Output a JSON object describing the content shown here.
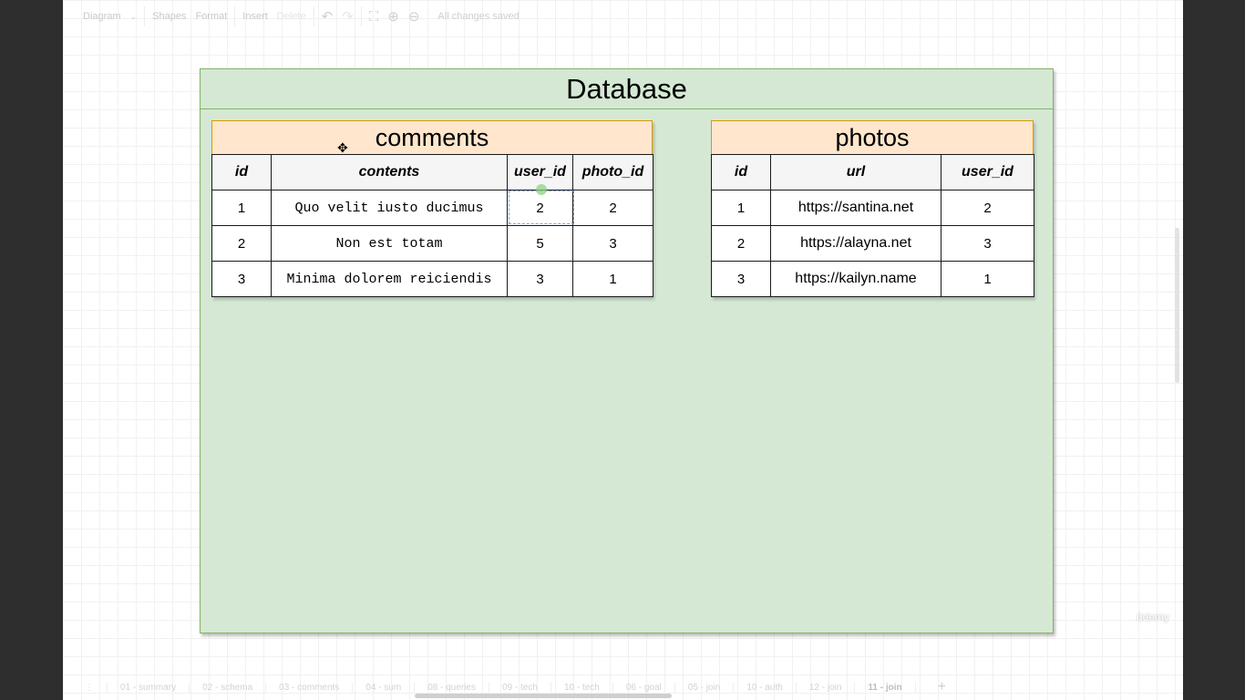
{
  "toolbar": {
    "diagram_menu": "Diagram",
    "shapes": "Shapes",
    "format": "Format",
    "insert": "Insert",
    "delete": "Delete",
    "status": "All changes saved"
  },
  "database": {
    "title": "Database"
  },
  "comments_table": {
    "title": "comments",
    "columns": [
      "id",
      "contents",
      "user_id",
      "photo_id"
    ],
    "rows": [
      [
        "1",
        "Quo velit iusto ducimus",
        "2",
        "2"
      ],
      [
        "2",
        "Non est totam",
        "5",
        "3"
      ],
      [
        "3",
        "Minima dolorem reiciendis",
        "3",
        "1"
      ]
    ]
  },
  "photos_table": {
    "title": "photos",
    "columns": [
      "id",
      "url",
      "user_id"
    ],
    "rows": [
      [
        "1",
        "https://santina.net",
        "2"
      ],
      [
        "2",
        "https://alayna.net",
        "3"
      ],
      [
        "3",
        "https://kailyn.name",
        "1"
      ]
    ]
  },
  "page_tabs": [
    "01 - summary",
    "02 - schema",
    "03 - comments",
    "04 - sum",
    "08 - queries",
    "09 - tech",
    "10 - tech",
    "06 - goal",
    "05 - join",
    "10 - auth",
    "12 - join",
    "11 - join"
  ],
  "active_tab": "11 - join",
  "watermark": "ûdemy",
  "colors": {
    "container_fill": "#d5e8d4",
    "container_stroke": "#82b366",
    "table_title_fill": "#ffe6cc",
    "table_title_stroke": "#d79b00"
  }
}
